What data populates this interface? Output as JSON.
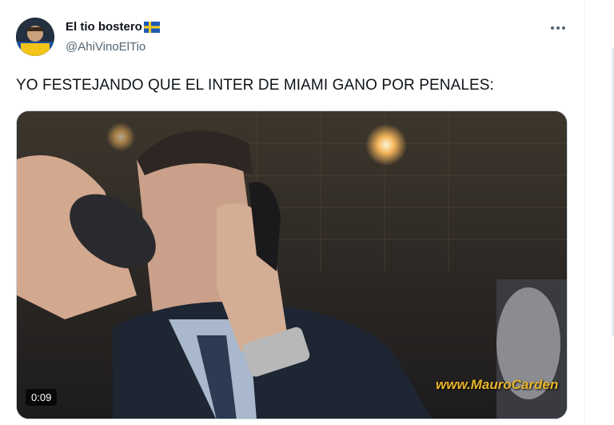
{
  "tweet": {
    "author": {
      "display_name": "El tio bostero",
      "flag_icon": "sweden-flag-icon",
      "handle": "@AhiVinoElTio"
    },
    "text": "YO FESTEJANDO QUE EL INTER DE MIAMI GANO POR PENALES:",
    "media": {
      "type": "video",
      "duration": "0:09",
      "watermark": "www.MauroCarden"
    },
    "more_icon": "more-dots-icon"
  }
}
